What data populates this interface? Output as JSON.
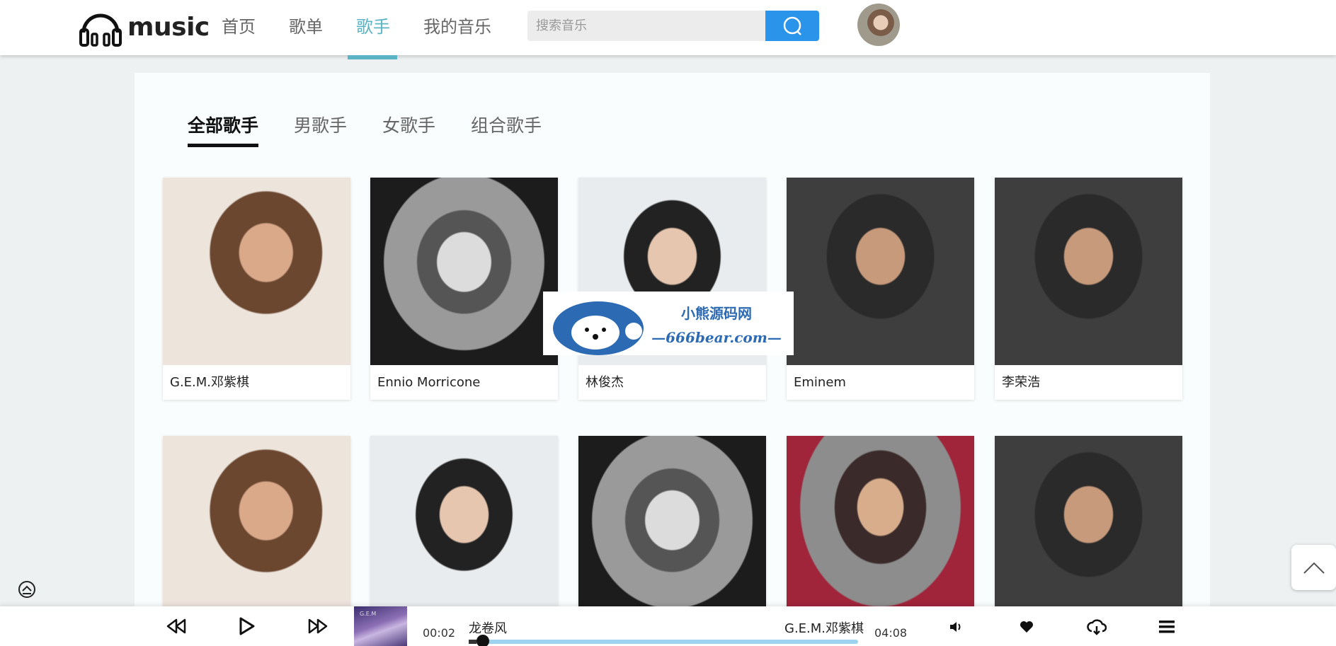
{
  "header": {
    "logo_text": "music",
    "nav": [
      {
        "label": "首页",
        "active": false
      },
      {
        "label": "歌单",
        "active": false
      },
      {
        "label": "歌手",
        "active": true
      },
      {
        "label": "我的音乐",
        "active": false
      }
    ],
    "search": {
      "placeholder": "搜索音乐",
      "value": ""
    }
  },
  "tabs": [
    {
      "label": "全部歌手",
      "active": true
    },
    {
      "label": "男歌手",
      "active": false
    },
    {
      "label": "女歌手",
      "active": false
    },
    {
      "label": "组合歌手",
      "active": false
    }
  ],
  "singers": [
    {
      "name": "G.E.M.邓紫棋",
      "tone": "warm"
    },
    {
      "name": "Ennio Morricone",
      "tone": "bw"
    },
    {
      "name": "林俊杰",
      "tone": "light"
    },
    {
      "name": "Eminem",
      "tone": "dark"
    },
    {
      "name": "李荣浩",
      "tone": "dark"
    },
    {
      "name": "",
      "tone": "warm"
    },
    {
      "name": "",
      "tone": "light"
    },
    {
      "name": "",
      "tone": "bw"
    },
    {
      "name": "",
      "tone": "red"
    },
    {
      "name": "",
      "tone": "dark"
    }
  ],
  "watermark": {
    "line1": "小熊源码网",
    "line2": "—666bear.com—"
  },
  "player": {
    "current_time": "00:02",
    "total_time": "04:08",
    "song_title": "龙卷风",
    "artist": "G.E.M.邓紫棋",
    "progress": 0.02,
    "album_caption": "G.E.M"
  },
  "colors": {
    "accent": "#5ab4c3",
    "search_button": "#2a94ea",
    "progress_track": "#9dd3ee"
  }
}
